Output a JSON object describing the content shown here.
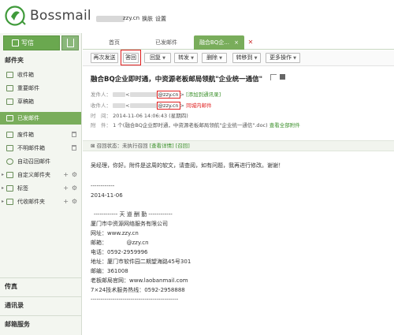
{
  "header": {
    "logo_text": "Bossmail",
    "user_domain": "zzy.cn",
    "switch_label": "换肤",
    "settings_label": "设置"
  },
  "sidebar": {
    "compose_label": "写信",
    "section_title": "邮件夹",
    "folders": [
      {
        "label": "收件箱"
      },
      {
        "label": "重要邮件"
      },
      {
        "label": "草稿箱"
      },
      {
        "label": "已发邮件"
      },
      {
        "label": "废件箱"
      },
      {
        "label": "不明邮件箱"
      },
      {
        "label": "自动召回邮件"
      },
      {
        "label": "自定义邮件夹"
      },
      {
        "label": "标签"
      },
      {
        "label": "代收邮件夹"
      }
    ],
    "bottom_sections": [
      "传真",
      "通讯录",
      "邮箱服务"
    ]
  },
  "tabs": [
    {
      "label": "首页"
    },
    {
      "label": "已发邮件"
    },
    {
      "label": "融合BQ企..."
    }
  ],
  "toolbar": {
    "resend": "再次发送",
    "reply": "答回",
    "reply_all": "回复",
    "forward": "转发",
    "delete": "删除",
    "move": "转移到",
    "more": "更多操作"
  },
  "mail": {
    "subject": "融合BQ企业即时通，中资源老板邮局领航\"企业统一通信\"",
    "sender_label": "发件人：",
    "sender_domain": "@zzy.cn",
    "sender_action": "[添加到通讯录]",
    "recipient_label": "收件人：",
    "recipient_domain": "@zzy.cn",
    "recipient_note": "同城内邮件",
    "time_label": "时　间：",
    "time_value": "2014-11-06 14:06:43 (星期四)",
    "attach_label": "附　件：",
    "attach_value": "1 个(融合BQ企业即时通，中资源老板邮局领航\"企业统一通信\".doc)",
    "attach_link": "查看全部附件",
    "reply_status": "召回状态：未执行召回",
    "reply_status_detail": "[查看详情]",
    "reply_status_action": "[召回]"
  },
  "body": {
    "greeting": "吴经理，你好。附件是这周的软文，请查阅，如有问题，我再进行修改。谢谢！",
    "dashes": "------------",
    "date": "2014-11-06",
    "sig_title": "------------ 天 道 酬 勤 ------------",
    "company": "厦门市中资源网络服务有限公司",
    "website": "网址：www.zzy.cn",
    "email": "邮箱：　　　　@zzy.cn",
    "phone": "电话：0592-2959996",
    "address": "地址：厦门市软件园二期望海路45号301",
    "postcode": "邮编：361008",
    "official_site": "老板邮局官网：www.laobanmail.com",
    "hotline": "7×24技术服务热线：0592-2958888",
    "footer_dashes": "--------------------------------------------"
  }
}
